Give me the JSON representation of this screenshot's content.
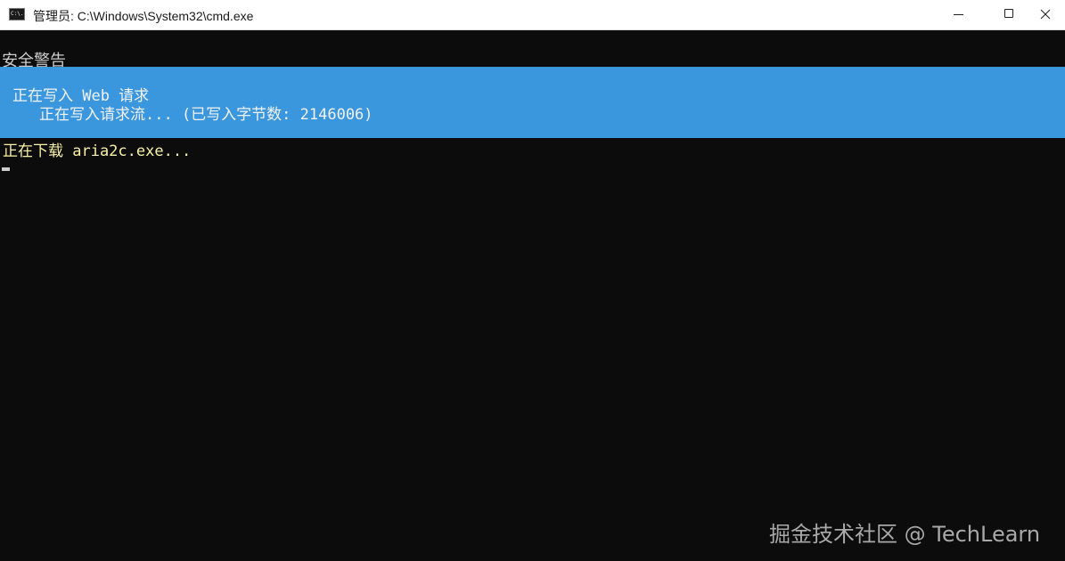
{
  "window": {
    "title": "管理员: C:\\Windows\\System32\\cmd.exe",
    "icon_label": "C:\\."
  },
  "controls": {
    "minimize": "minimize",
    "maximize": "maximize",
    "close": "close"
  },
  "console": {
    "security_warning": "安全警告",
    "progress_line1": "正在写入 Web 请求",
    "progress_line2": "正在写入请求流... (已写入字节数: 2146006)",
    "downloading": "正在下载 aria2c.exe..."
  },
  "watermark": "掘金技术社区 @ TechLearn",
  "colors": {
    "console_bg": "#0c0c0c",
    "progress_bg": "#3a96dd",
    "text_default": "#cccccc",
    "text_yellow": "#f9f1a5"
  }
}
